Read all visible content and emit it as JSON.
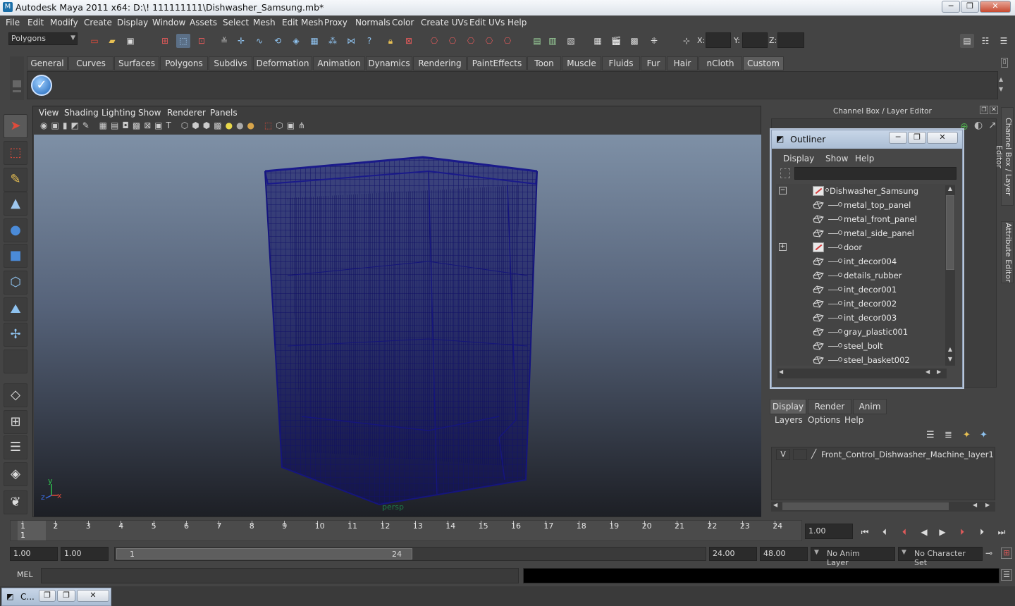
{
  "window": {
    "title": "Autodesk Maya 2011 x64: D:\\! 111111111\\Dishwasher_Samsung.mb*",
    "min": "─",
    "max": "❐",
    "close": "✕"
  },
  "menubar": [
    "File",
    "Edit",
    "Modify",
    "Create",
    "Display",
    "Window",
    "Assets",
    "Select",
    "Mesh",
    "Edit Mesh",
    "Proxy",
    "Normals",
    "Color",
    "Create UVs",
    "Edit UVs",
    "Help"
  ],
  "statusline": {
    "mode": "Polygons",
    "x_label": "X:",
    "y_label": "Y:",
    "z_label": "Z:"
  },
  "shelf_tabs": [
    "General",
    "Curves",
    "Surfaces",
    "Polygons",
    "Subdivs",
    "Deformation",
    "Animation",
    "Dynamics",
    "Rendering",
    "PaintEffects",
    "Toon",
    "Muscle",
    "Fluids",
    "Fur",
    "Hair",
    "nCloth",
    "Custom"
  ],
  "active_shelf_tab": "Custom",
  "viewport": {
    "menu": [
      "View",
      "Shading",
      "Lighting",
      "Show",
      "Renderer",
      "Panels"
    ],
    "camera_label": "persp",
    "axis_y": "y",
    "axis_x": "x",
    "axis_z": "z"
  },
  "channelbox": {
    "title": "Channel Box / Layer Editor",
    "side_tabs": [
      "Channel Box / Layer Editor",
      "Attribute Editor"
    ]
  },
  "outliner": {
    "title": "Outliner",
    "menu": [
      "Display",
      "Show",
      "Help"
    ],
    "search_value": "",
    "root": "Dishwasher_Samsung",
    "items": [
      "metal_top_panel",
      "metal_front_panel",
      "metal_side_panel",
      "door",
      "int_decor004",
      "details_rubber",
      "int_decor001",
      "int_decor002",
      "int_decor003",
      "gray_plastic001",
      "steel_bolt",
      "steel_basket002"
    ],
    "expanded_marker": "−",
    "collapsed_marker": "+"
  },
  "layer_editor": {
    "tabs": [
      "Display",
      "Render",
      "Anim"
    ],
    "active_tab": "Display",
    "menu": [
      "Layers",
      "Options",
      "Help"
    ],
    "layer": {
      "visible_flag": "V",
      "name": "Front_Control_Dishwasher_Machine_layer1"
    }
  },
  "timeline": {
    "ticks": [
      "1",
      "2",
      "3",
      "4",
      "5",
      "6",
      "7",
      "8",
      "9",
      "10",
      "11",
      "12",
      "13",
      "14",
      "15",
      "16",
      "17",
      "18",
      "19",
      "20",
      "21",
      "22",
      "23",
      "24"
    ],
    "current_frame_marker": "1",
    "current_time": "1.00"
  },
  "range": {
    "start": "1.00",
    "start_inner": "1.00",
    "slider_start": "1",
    "slider_end": "24",
    "end": "24.00",
    "end_outer": "48.00",
    "anim_layer": "No Anim Layer",
    "character_set": "No Character Set"
  },
  "cmdline": {
    "label": "MEL",
    "value": "",
    "result": ""
  },
  "taskbar": {
    "item": "C..."
  }
}
